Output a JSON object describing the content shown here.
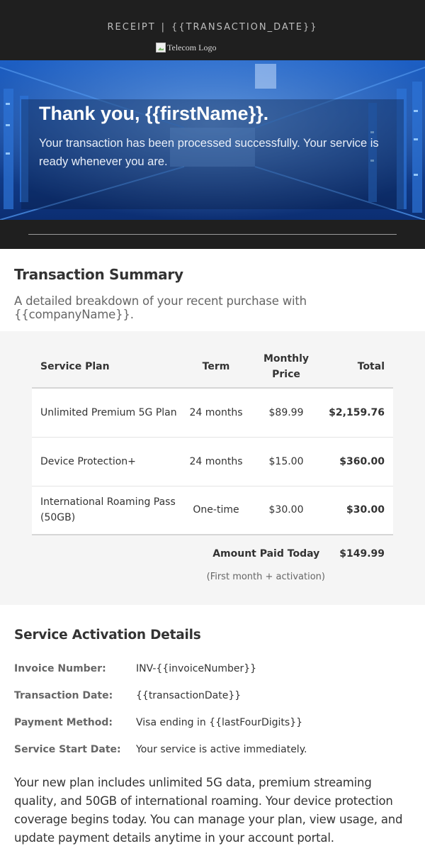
{
  "header": {
    "eyebrow_label": "RECEIPT",
    "eyebrow_separator": "|",
    "eyebrow_date": "{{TRANSACTION_DATE}}",
    "logo_alt": "Telecom Logo"
  },
  "hero": {
    "title": "Thank you, {{firstName}}.",
    "message": "Your transaction has been processed successfully. Your service is ready whenever you are."
  },
  "summary": {
    "title": "Transaction Summary",
    "subtitle": "A detailed breakdown of your recent purchase with {{companyName}}."
  },
  "table": {
    "headers": {
      "plan": "Service Plan",
      "term": "Term",
      "price": "Monthly Price",
      "total": "Total"
    },
    "rows": [
      {
        "plan": "Unlimited Premium 5G Plan",
        "term": "24 months",
        "price": "$89.99",
        "total": "$2,159.76"
      },
      {
        "plan": "Device Protection+",
        "term": "24 months",
        "price": "$15.00",
        "total": "$360.00"
      },
      {
        "plan": "International Roaming Pass (50GB)",
        "term": "One-time",
        "price": "$30.00",
        "total": "$30.00"
      }
    ],
    "paid_label": "Amount Paid Today",
    "paid_amount": "$149.99",
    "paid_note": "(First month + activation)"
  },
  "details": {
    "title": "Service Activation Details",
    "fields": [
      {
        "label": "Invoice Number:",
        "value": "INV-{{invoiceNumber}}"
      },
      {
        "label": "Transaction Date:",
        "value": "{{transactionDate}}"
      },
      {
        "label": "Payment Method:",
        "value": "Visa ending in {{lastFourDigits}}"
      },
      {
        "label": "Service Start Date:",
        "value": "Your service is active immediately."
      }
    ],
    "paragraph": "Your new plan includes unlimited 5G data, premium streaming quality, and 50GB of international roaming. Your device protection coverage begins today. You can manage your plan, view usage, and update payment details anytime in your account portal."
  },
  "colors": {
    "dark_band": "#1f1f1f",
    "hero_blue": "#12408f",
    "table_bg": "#f5f5f5"
  }
}
